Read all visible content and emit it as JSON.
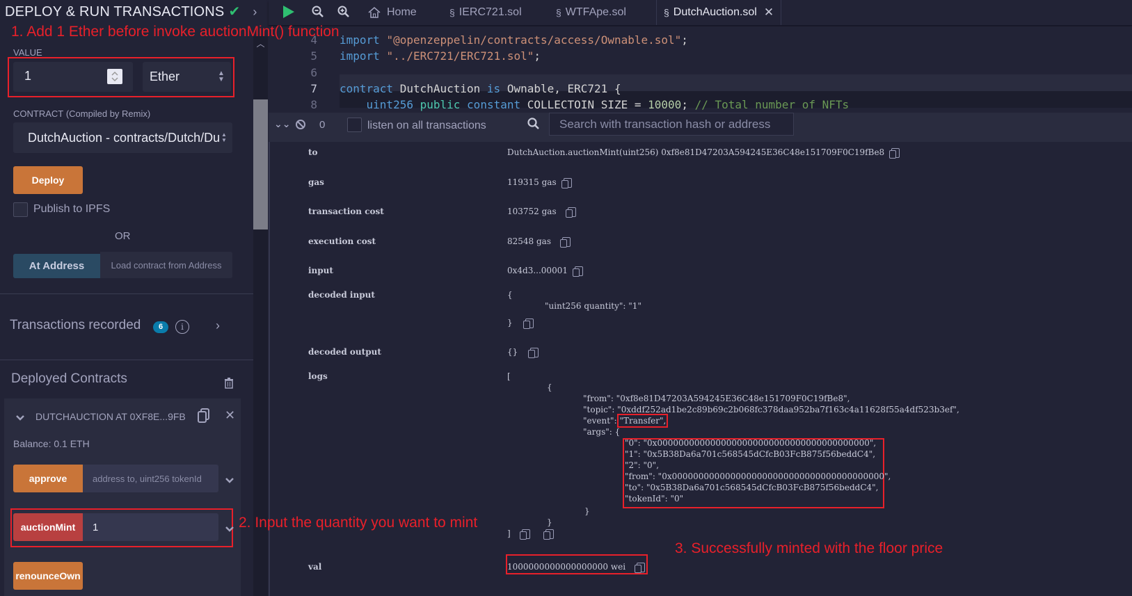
{
  "left_panel": {
    "title": "DEPLOY & RUN TRANSACTIONS",
    "title_check": "✔",
    "title_chevron": "›",
    "annotation_1": "1. Add 1 Ether before invoke auctionMint() function",
    "value_label": "VALUE",
    "value_input": "1",
    "value_unit": "Ether",
    "contract_label": "CONTRACT",
    "contract_label_sub": "(Compiled by Remix)",
    "contract_select": "DutchAuction - contracts/Dutch/Du",
    "deploy_label": "Deploy",
    "publish_ipfs_label": "Publish to IPFS",
    "or_label": "OR",
    "at_address_label": "At Address",
    "load_contract_placeholder": "Load contract from Address",
    "transactions_recorded_label": "Transactions recorded",
    "transactions_recorded_count": "6",
    "deployed_contracts_label": "Deployed Contracts",
    "deployed_instance": {
      "title": "DUTCHAUCTION AT 0XF8E...9FBE",
      "balance": "Balance: 0.1 ETH",
      "functions": [
        {
          "name": "approve",
          "placeholder": "address to, uint256 tokenId",
          "value": "",
          "color": "#c97539"
        },
        {
          "name": "auctionMint",
          "placeholder": "",
          "value": "1",
          "color": "#b84040"
        },
        {
          "name": "renounceOwn",
          "placeholder": "",
          "value": "",
          "color": "#c97539"
        }
      ]
    },
    "annotation_2": "2. Input the quantity you want to mint"
  },
  "tabs": {
    "run_icon": "play-icon",
    "items": [
      {
        "label": "Home",
        "icon": "home-icon"
      },
      {
        "label": "IERC721.sol",
        "icon": "solidity-icon"
      },
      {
        "label": "WTFApe.sol",
        "icon": "solidity-icon"
      },
      {
        "label": "DutchAuction.sol",
        "icon": "solidity-icon",
        "active": true
      }
    ]
  },
  "editor": {
    "lines": [
      {
        "no": "4",
        "code": "import \"@openzeppelin/contracts/access/Ownable.sol\";"
      },
      {
        "no": "5",
        "code": "import \"../ERC721/ERC721.sol\";"
      },
      {
        "no": "6",
        "code": ""
      },
      {
        "no": "7",
        "code": "contract DutchAuction is Ownable, ERC721 {"
      },
      {
        "no": "8",
        "code": "    uint256 public constant COLLECTOIN SIZE = 10000; // Total number of NFTs"
      }
    ]
  },
  "terminal_bar": {
    "pending_count": "0",
    "listen_label": "listen on all transactions",
    "search_placeholder": "Search with transaction hash or address"
  },
  "tx_details": {
    "to_key": "to",
    "to_value": "DutchAuction.auctionMint(uint256) 0xf8e81D47203A594245E36C48e151709F0C19fBe8",
    "gas_key": "gas",
    "gas_value": "119315 gas",
    "tx_cost_key": "transaction cost",
    "tx_cost_value": "103752 gas",
    "exec_cost_key": "execution cost",
    "exec_cost_value": "82548 gas",
    "input_key": "input",
    "input_value": "0x4d3...00001",
    "decoded_input_key": "decoded input",
    "decoded_input_open": "{",
    "decoded_input_line": "\"uint256 quantity\": \"1\"",
    "decoded_input_close": "}",
    "decoded_output_key": "decoded output",
    "decoded_output_value": "{}",
    "logs_key": "logs",
    "logs": {
      "open_bracket": "[",
      "open_brace": "{",
      "from_line": "\"from\": \"0xf8e81D47203A594245E36C48e151709F0C19fBe8\",",
      "topic_line": "\"topic\": \"0xddf252ad1be2c89b69c2b068fc378daa952ba7f163c4a11628f55a4df523b3ef\",",
      "event_key": "\"event\": ",
      "event_value": "\"Transfer\",",
      "args_key": "\"args\": {",
      "args": [
        "\"0\": \"0x0000000000000000000000000000000000000000\",",
        "\"1\": \"0x5B38Da6a701c568545dCfcB03FcB875f56beddC4\",",
        "\"2\": \"0\",",
        "\"from\": \"0x0000000000000000000000000000000000000000\",",
        "\"to\": \"0x5B38Da6a701c568545dCfcB03FcB875f56beddC4\",",
        "\"tokenId\": \"0\""
      ],
      "args_close": "}",
      "close_brace": "}",
      "close_bracket": "]"
    },
    "val_key": "val",
    "val_value": "1000000000000000000 wei"
  },
  "annotation_3": "3. Successfully minted with the floor price"
}
